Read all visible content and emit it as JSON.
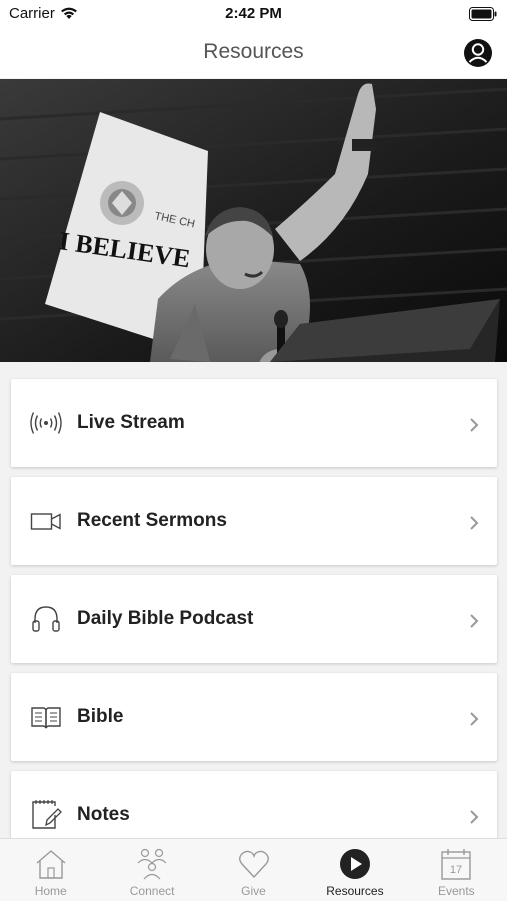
{
  "status_bar": {
    "carrier": "Carrier",
    "time": "2:42 PM"
  },
  "nav": {
    "title": "Resources"
  },
  "hero": {
    "banner_text": "I BELIEVE",
    "banner_subtext": "THE CH"
  },
  "resources": [
    {
      "label": "Live Stream",
      "icon": "live-stream-icon"
    },
    {
      "label": "Recent Sermons",
      "icon": "video-camera-icon"
    },
    {
      "label": "Daily Bible Podcast",
      "icon": "headphones-icon"
    },
    {
      "label": "Bible",
      "icon": "book-icon"
    },
    {
      "label": "Notes",
      "icon": "notes-icon"
    }
  ],
  "tabs": [
    {
      "label": "Home",
      "icon": "home-icon",
      "active": false
    },
    {
      "label": "Connect",
      "icon": "people-icon",
      "active": false
    },
    {
      "label": "Give",
      "icon": "heart-icon",
      "active": false
    },
    {
      "label": "Resources",
      "icon": "play-circle-icon",
      "active": true
    },
    {
      "label": "Events",
      "icon": "calendar-icon",
      "active": false
    }
  ],
  "calendar_day": "17",
  "colors": {
    "accent": "#222222",
    "inactive": "#999999",
    "background": "#f2f2f2"
  }
}
